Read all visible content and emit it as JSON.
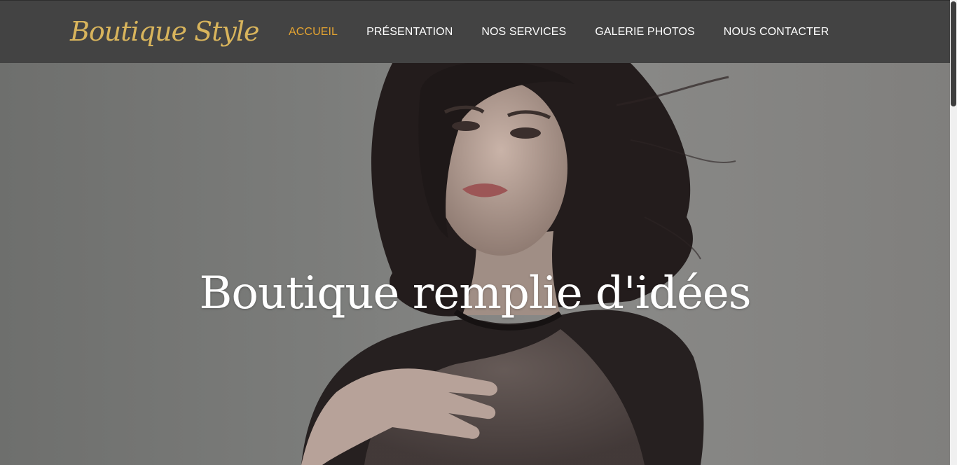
{
  "brand": {
    "logo_text": "Boutique Style"
  },
  "nav": {
    "items": [
      {
        "label": "ACCUEIL"
      },
      {
        "label": "PRÉSENTATION"
      },
      {
        "label": "NOS SERVICES"
      },
      {
        "label": "GALERIE PHOTOS"
      },
      {
        "label": "NOUS CONTACTER"
      }
    ],
    "active_index": 0
  },
  "hero": {
    "title": "Boutique remplie d'idées"
  },
  "colors": {
    "navbar_bg": "#434343",
    "accent": "#e5a431",
    "logo": "#d8b45c",
    "nav_text": "#ffffff"
  }
}
